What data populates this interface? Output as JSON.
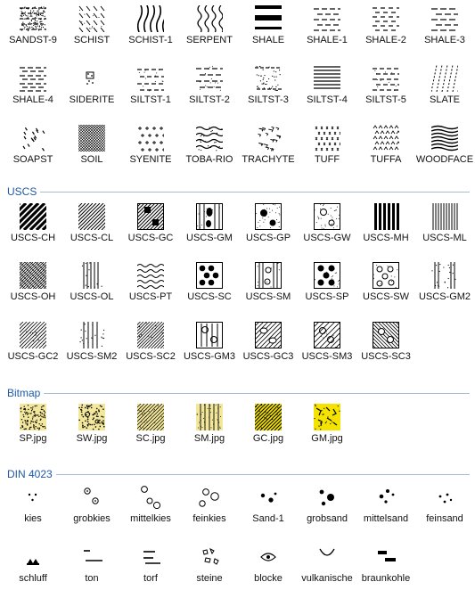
{
  "top_rows": [
    [
      {
        "label": "SANDST-9",
        "icon": "sandst-9-pattern",
        "pattern": "sandst9"
      },
      {
        "label": "SCHIST",
        "icon": "schist-pattern",
        "pattern": "schist"
      },
      {
        "label": "SCHIST-1",
        "icon": "schist-1-pattern",
        "pattern": "schist1"
      },
      {
        "label": "SERPENT",
        "icon": "serpent-pattern",
        "pattern": "serpent"
      },
      {
        "label": "SHALE",
        "icon": "shale-pattern",
        "pattern": "shale"
      },
      {
        "label": "SHALE-1",
        "icon": "shale-1-pattern",
        "pattern": "shale1"
      },
      {
        "label": "SHALE-2",
        "icon": "shale-2-pattern",
        "pattern": "shale2"
      },
      {
        "label": "SHALE-3",
        "icon": "shale-3-pattern",
        "pattern": "shale3"
      }
    ],
    [
      {
        "label": "SHALE-4",
        "icon": "shale-4-pattern",
        "pattern": "shale4"
      },
      {
        "label": "SIDERITE",
        "icon": "siderite-pattern",
        "pattern": "siderite"
      },
      {
        "label": "SILTST-1",
        "icon": "siltst-1-pattern",
        "pattern": "siltst1"
      },
      {
        "label": "SILTST-2",
        "icon": "siltst-2-pattern",
        "pattern": "siltst2"
      },
      {
        "label": "SILTST-3",
        "icon": "siltst-3-pattern",
        "pattern": "siltst3"
      },
      {
        "label": "SILTST-4",
        "icon": "siltst-4-pattern",
        "pattern": "siltst4"
      },
      {
        "label": "SILTST-5",
        "icon": "siltst-5-pattern",
        "pattern": "siltst5"
      },
      {
        "label": "SLATE",
        "icon": "slate-pattern",
        "pattern": "slate"
      }
    ],
    [
      {
        "label": "SOAPST",
        "icon": "soapst-pattern",
        "pattern": "soapst"
      },
      {
        "label": "SOIL",
        "icon": "soil-pattern",
        "pattern": "soil"
      },
      {
        "label": "SYENITE",
        "icon": "syenite-pattern",
        "pattern": "syenite"
      },
      {
        "label": "TOBA-RIO",
        "icon": "toba-rio-pattern",
        "pattern": "tobario"
      },
      {
        "label": "TRACHYTE",
        "icon": "trachyte-pattern",
        "pattern": "trachyte"
      },
      {
        "label": "TUFF",
        "icon": "tuff-pattern",
        "pattern": "tuff"
      },
      {
        "label": "TUFFA",
        "icon": "tuffa-pattern",
        "pattern": "tuffa"
      },
      {
        "label": "WOODFACE",
        "icon": "woodface-pattern",
        "pattern": "woodface"
      }
    ]
  ],
  "sections": {
    "uscs": {
      "title": "USCS",
      "rows": [
        [
          {
            "label": "USCS-CH",
            "icon": "uscs-ch-pattern",
            "pattern": "ch"
          },
          {
            "label": "USCS-CL",
            "icon": "uscs-cl-pattern",
            "pattern": "cl"
          },
          {
            "label": "USCS-GC",
            "icon": "uscs-gc-pattern",
            "pattern": "gc"
          },
          {
            "label": "USCS-GM",
            "icon": "uscs-gm-pattern",
            "pattern": "gm"
          },
          {
            "label": "USCS-GP",
            "icon": "uscs-gp-pattern",
            "pattern": "gp"
          },
          {
            "label": "USCS-GW",
            "icon": "uscs-gw-pattern",
            "pattern": "gw"
          },
          {
            "label": "USCS-MH",
            "icon": "uscs-mh-pattern",
            "pattern": "mh"
          },
          {
            "label": "USCS-ML",
            "icon": "uscs-ml-pattern",
            "pattern": "ml"
          }
        ],
        [
          {
            "label": "USCS-OH",
            "icon": "uscs-oh-pattern",
            "pattern": "oh"
          },
          {
            "label": "USCS-OL",
            "icon": "uscs-ol-pattern",
            "pattern": "ol"
          },
          {
            "label": "USCS-PT",
            "icon": "uscs-pt-pattern",
            "pattern": "pt"
          },
          {
            "label": "USCS-SC",
            "icon": "uscs-sc-pattern",
            "pattern": "sc"
          },
          {
            "label": "USCS-SM",
            "icon": "uscs-sm-pattern",
            "pattern": "sm"
          },
          {
            "label": "USCS-SP",
            "icon": "uscs-sp-pattern",
            "pattern": "sp"
          },
          {
            "label": "USCS-SW",
            "icon": "uscs-sw-pattern",
            "pattern": "swp"
          },
          {
            "label": "USCS-GM2",
            "icon": "uscs-gm2-pattern",
            "pattern": "gm2"
          }
        ],
        [
          {
            "label": "USCS-GC2",
            "icon": "uscs-gc2-pattern",
            "pattern": "gc2"
          },
          {
            "label": "USCS-SM2",
            "icon": "uscs-sm2-pattern",
            "pattern": "sm2"
          },
          {
            "label": "USCS-SC2",
            "icon": "uscs-sc2-pattern",
            "pattern": "sc2"
          },
          {
            "label": "USCS-GM3",
            "icon": "uscs-gm3-pattern",
            "pattern": "gm3"
          },
          {
            "label": "USCS-GC3",
            "icon": "uscs-gc3-pattern",
            "pattern": "gc3"
          },
          {
            "label": "USCS-SM3",
            "icon": "uscs-sm3-pattern",
            "pattern": "sm3"
          },
          {
            "label": "USCS-SC3",
            "icon": "uscs-sc3-pattern",
            "pattern": "sc3"
          }
        ]
      ]
    },
    "bitmap": {
      "title": "Bitmap",
      "rows": [
        [
          {
            "label": "SP.jpg",
            "icon": "sp-jpg-thumbnail",
            "pattern": "bmpsp"
          },
          {
            "label": "SW.jpg",
            "icon": "sw-jpg-thumbnail",
            "pattern": "bmpsw"
          },
          {
            "label": "SC.jpg",
            "icon": "sc-jpg-thumbnail",
            "pattern": "bmpsc"
          },
          {
            "label": "SM.jpg",
            "icon": "sm-jpg-thumbnail",
            "pattern": "bmpsm"
          },
          {
            "label": "GC.jpg",
            "icon": "gc-jpg-thumbnail",
            "pattern": "bmpgc"
          },
          {
            "label": "GM.jpg",
            "icon": "gm-jpg-thumbnail",
            "pattern": "bmpgm"
          }
        ]
      ]
    },
    "din": {
      "title": "DIN 4023",
      "rows": [
        [
          {
            "label": "kies",
            "icon": "kies-symbol",
            "pattern": "kies"
          },
          {
            "label": "grobkies",
            "icon": "grobkies-symbol",
            "pattern": "grobkies"
          },
          {
            "label": "mittelkies",
            "icon": "mittelkies-symbol",
            "pattern": "mittelkies"
          },
          {
            "label": "feinkies",
            "icon": "feinkies-symbol",
            "pattern": "feinkies"
          },
          {
            "label": "Sand-1",
            "icon": "sand-1-symbol",
            "pattern": "sand1"
          },
          {
            "label": "grobsand",
            "icon": "grobsand-symbol",
            "pattern": "grobsand"
          },
          {
            "label": "mittelsand",
            "icon": "mittelsand-symbol",
            "pattern": "mittelsand"
          },
          {
            "label": "feinsand",
            "icon": "feinsand-symbol",
            "pattern": "feinsand"
          }
        ],
        [
          {
            "label": "schluff",
            "icon": "schluff-symbol",
            "pattern": "schluff"
          },
          {
            "label": "ton",
            "icon": "ton-symbol",
            "pattern": "ton"
          },
          {
            "label": "torf",
            "icon": "torf-symbol",
            "pattern": "torf"
          },
          {
            "label": "steine",
            "icon": "steine-symbol",
            "pattern": "steine"
          },
          {
            "label": "blocke",
            "icon": "blocke-symbol",
            "pattern": "blocke"
          },
          {
            "label": "vulkanische",
            "icon": "vulkanische-symbol",
            "pattern": "vulkanische"
          },
          {
            "label": "braunkohle",
            "icon": "braunkohle-symbol",
            "pattern": "braunkohle"
          }
        ]
      ]
    }
  },
  "colors": {
    "section_title": "#1e5aa8",
    "section_line": "#a9bcd6",
    "bitmap_yellow": "#f2e79a",
    "bitmap_bright": "#f4e300"
  }
}
